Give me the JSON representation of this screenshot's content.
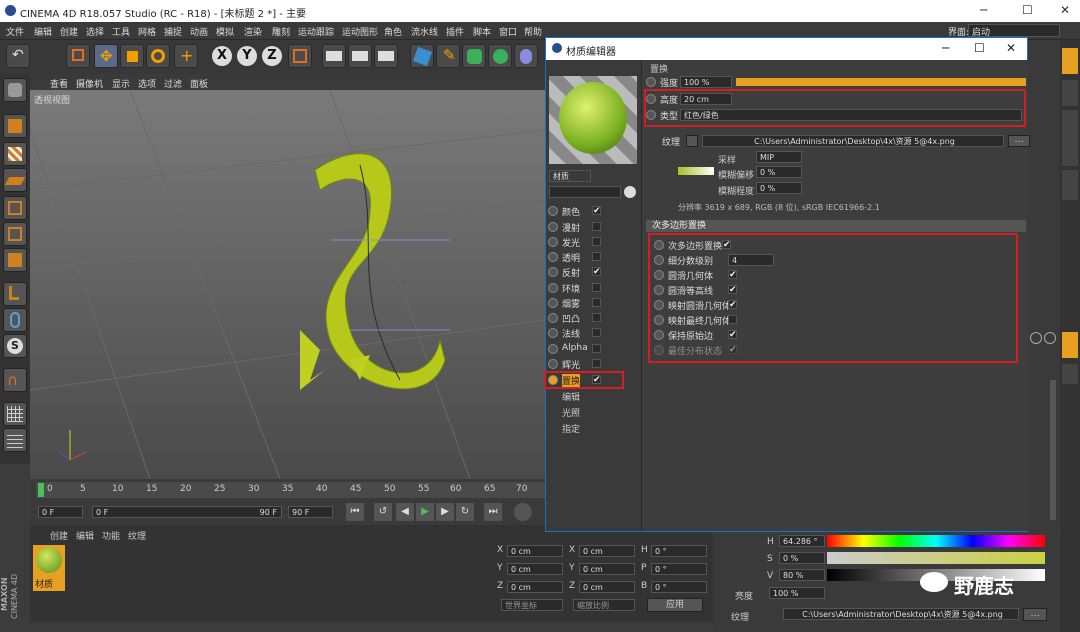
{
  "window": {
    "title": "CINEMA 4D R18.057 Studio (RC - R18) - [未标题 2 *] - 主要"
  },
  "menu": [
    "文件",
    "编辑",
    "创建",
    "选择",
    "工具",
    "网格",
    "捕捉",
    "动画",
    "模拟",
    "渲染",
    "雕刻",
    "运动跟踪",
    "运动图形",
    "角色",
    "流水线",
    "插件",
    "脚本",
    "窗口",
    "帮助"
  ],
  "layout_label": "界面:",
  "layout_value": "启动",
  "viewport": {
    "menu": [
      "查看",
      "摄像机",
      "显示",
      "选项",
      "过滤",
      "面板"
    ],
    "label": "透视视图"
  },
  "timeline": {
    "ticks": [
      "0",
      "5",
      "10",
      "15",
      "20",
      "25",
      "30",
      "35",
      "40",
      "45",
      "50",
      "55",
      "60",
      "65",
      "70"
    ],
    "start": "0 F",
    "cur": "0 F",
    "end": "90 F",
    "end2": "90 F"
  },
  "bottom": {
    "menu": [
      "创建",
      "编辑",
      "功能",
      "纹理"
    ],
    "material_name": "材质",
    "logo_line1": "MAXON",
    "logo_line2": "CINEMA 4D"
  },
  "coords": {
    "rows": [
      [
        "X",
        "0 cm",
        "X",
        "0 cm",
        "H",
        "0 °"
      ],
      [
        "Y",
        "0 cm",
        "Y",
        "0 cm",
        "P",
        "0 °"
      ],
      [
        "Z",
        "0 cm",
        "Z",
        "0 cm",
        "B",
        "0 °"
      ]
    ],
    "mode1": "世界坐标",
    "mode2": "缩放比例",
    "apply": "应用"
  },
  "attr": {
    "H": "64.286 °",
    "S": "0 %",
    "V": "80 %",
    "brightness_label": "亮度",
    "brightness": "100 %",
    "texture_label": "纹理",
    "texture_path": "C:\\Users\\Administrator\\Desktop\\4x\\资源 5@4x.png",
    "labels": [
      "H",
      "S",
      "V"
    ]
  },
  "watermark": "野鹿志",
  "material_editor": {
    "title": "材质编辑器",
    "mat_name": "材质",
    "channels": [
      {
        "name": "颜色",
        "on": true
      },
      {
        "name": "漫射",
        "on": false
      },
      {
        "name": "发光",
        "on": false
      },
      {
        "name": "透明",
        "on": false
      },
      {
        "name": "反射",
        "on": true
      },
      {
        "name": "环境",
        "on": false
      },
      {
        "name": "烟雾",
        "on": false
      },
      {
        "name": "凹凸",
        "on": false
      },
      {
        "name": "法线",
        "on": false
      },
      {
        "name": "Alpha",
        "on": false
      },
      {
        "name": "辉光",
        "on": false
      },
      {
        "name": "置换",
        "on": true
      }
    ],
    "extras": [
      "编辑",
      "光照",
      "指定"
    ],
    "section": "置换",
    "strength_label": "强度",
    "strength": "100 %",
    "height_label": "高度",
    "height": "20 cm",
    "type_label": "类型",
    "type": "红色/绿色",
    "texture_label": "纹理",
    "texture_path": "C:\\Users\\Administrator\\Desktop\\4x\\资源 5@4x.png",
    "sample_label": "采样",
    "sample": "MIP",
    "blur_offset_label": "模糊偏移",
    "blur_offset": "0 %",
    "blur_scale_label": "模糊程度",
    "blur_scale": "0 %",
    "resolution": "分辨率 3619 x 689, RGB (8 位), sRGB IEC61966-2.1",
    "subpoly_section": "次多边形置换",
    "sub": [
      {
        "name": "次多边形置换",
        "val": "✔"
      },
      {
        "name": "细分数级别",
        "val": "4"
      },
      {
        "name": "圆滑几何体",
        "val": "✔"
      },
      {
        "name": "圆滑等高线",
        "val": "✔"
      },
      {
        "name": "映射圆滑几何体",
        "val": "✔"
      },
      {
        "name": "映射最终几何体",
        "val": ""
      },
      {
        "name": "保持原始边",
        "val": "✔"
      },
      {
        "name": "最佳分布状态",
        "val": "✔"
      }
    ]
  }
}
